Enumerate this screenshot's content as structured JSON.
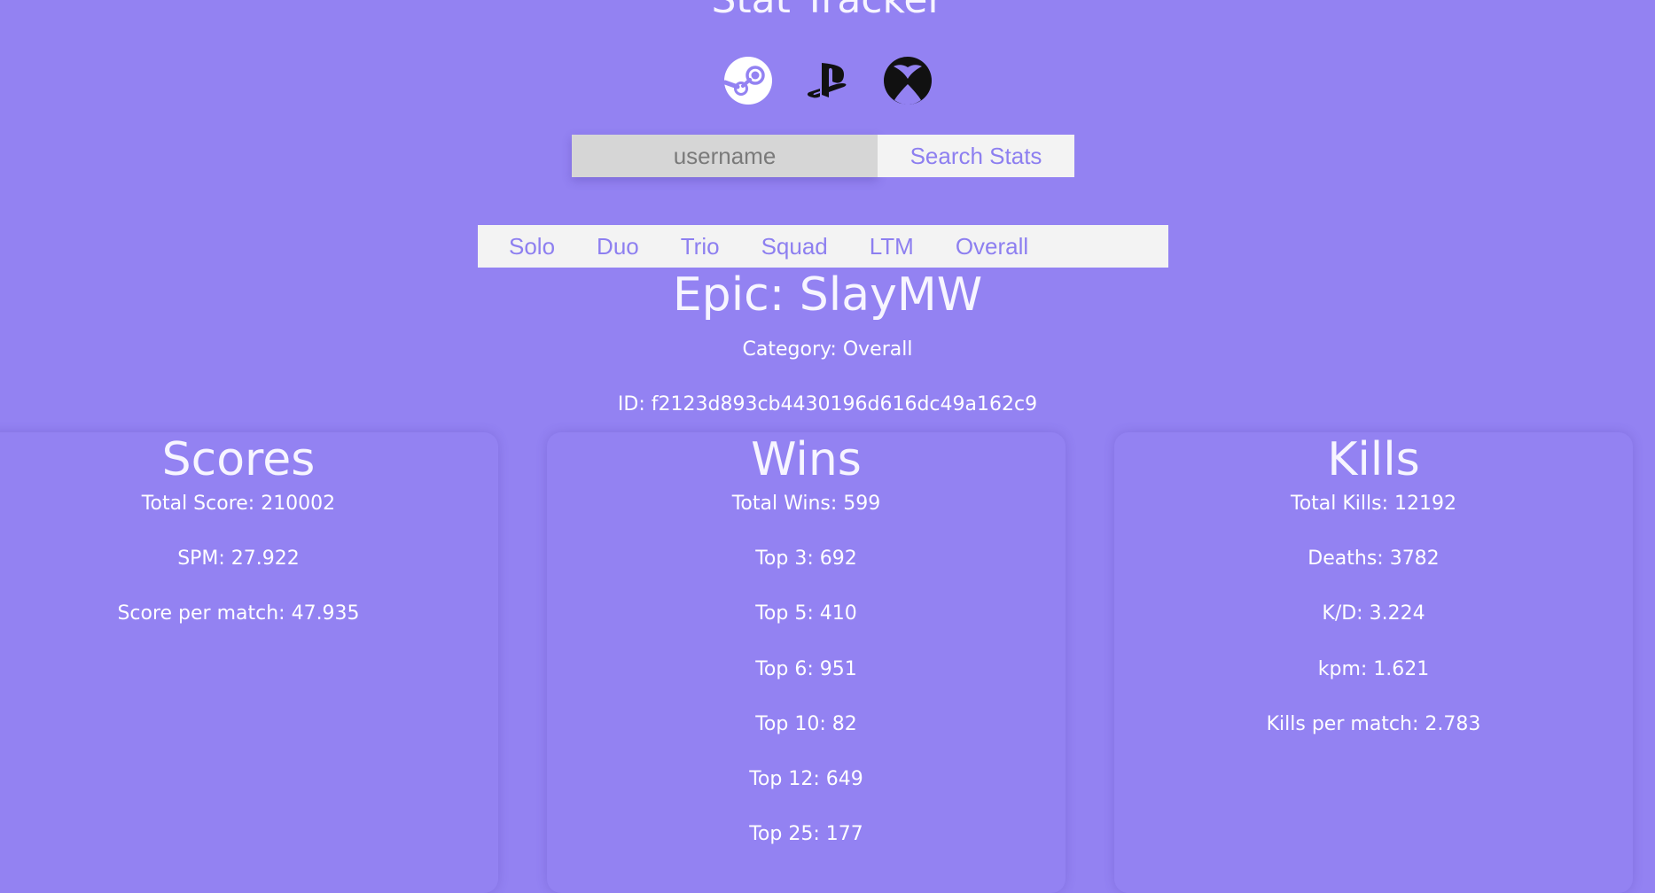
{
  "app": {
    "title": "Stat Tracker"
  },
  "platforms": [
    {
      "name": "steam",
      "icon": "steam-icon"
    },
    {
      "name": "playstation",
      "icon": "playstation-icon"
    },
    {
      "name": "xbox",
      "icon": "xbox-icon"
    }
  ],
  "search": {
    "placeholder": "username",
    "value": "",
    "button_label": "Search Stats"
  },
  "tabs": [
    "Solo",
    "Duo",
    "Trio",
    "Squad",
    "LTM",
    "Overall"
  ],
  "player": {
    "name": "Epic: SlayMW",
    "category": "Category: Overall",
    "id": "ID: f2123d893cb4430196d616dc49a162c9"
  },
  "cards": {
    "scores": {
      "title": "Scores",
      "items": [
        "Total Score: 210002",
        "SPM: 27.922",
        "Score per match: 47.935"
      ]
    },
    "wins": {
      "title": "Wins",
      "items": [
        "Total Wins: 599",
        "Top 3: 692",
        "Top 5: 410",
        "Top 6: 951",
        "Top 10: 82",
        "Top 12: 649",
        "Top 25: 177"
      ]
    },
    "kills": {
      "title": "Kills",
      "items": [
        "Total Kills: 12192",
        "Deaths: 3782",
        "K/D: 3.224",
        "kpm: 1.621",
        "Kills per match: 2.783"
      ]
    }
  },
  "colors": {
    "background": "#9382f2",
    "accent": "#8d7ff0",
    "panel": "#f3f3f3",
    "input": "#d6d6d6"
  }
}
